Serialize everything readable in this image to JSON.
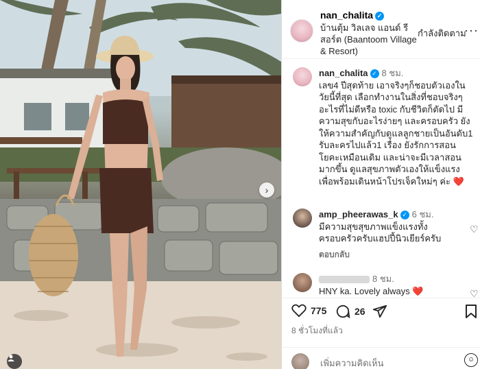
{
  "post": {
    "username": "nan_chalita",
    "location": "บ้านตุ้ม วิลเลจ แอนด์ รีสอร์ต (Baantoom Village & Resort)",
    "follow_label": "กำลังติดตาม",
    "more_label": "···"
  },
  "comments": [
    {
      "username": "nan_chalita",
      "time": "8 ชม.",
      "text": "เลข4 ปีสุดท้าย เอาจริงๆก็ชอบตัวเองในวัยนี้ที่สุด เลือกทำงานในสิ่งที่ชอบจริงๆ อะไรที่ไม่ดีหรือ toxic กับชีวิตก็ตัดไป มีความสุขกับอะไรง่ายๆ และครอบครัว ยังให้ความสำคัญกับดูแลลูกชายเป็นอันดับ1 รับละครไปแล้ว1 เรื่อง ยังรักการสอนโยคะเหมือนเดิม และน่าจะมีเวลาสอนมากขึ้น ดูแลสุขภาพตัวเองให้แข็งแรง เพื่อพร้อมเดินหน้าโปรเจ็คใหม่ๆ ค่ะ ❤️"
    },
    {
      "username": "amp_pheerawas_k",
      "time": "6 ชม.",
      "text": "มีความสุขสุขภาพแข็งแรงทั้งครอบครัวครับแฮปปี้นิวเยียร์ครับ",
      "reply_label": "ตอบกลับ"
    },
    {
      "username": "",
      "time": "8 ชม.",
      "text": "HNY ka. Lovely always ❤️"
    }
  ],
  "actions": {
    "likes": "775",
    "comments": "26",
    "posted_ago": "8 ชั่วโมงที่แล้ว"
  },
  "add_comment": {
    "placeholder": "เพิ่มความคิดเห็น"
  },
  "icons": [
    "verified-icon",
    "more-icon",
    "heart-icon",
    "comment-icon",
    "share-icon",
    "save-icon",
    "emoji-icon",
    "chevron-right-icon",
    "user-tag-icon"
  ],
  "colors": {
    "accent": "#0095f6",
    "text": "#262626",
    "muted": "#737373",
    "heart": "#ed4956"
  }
}
